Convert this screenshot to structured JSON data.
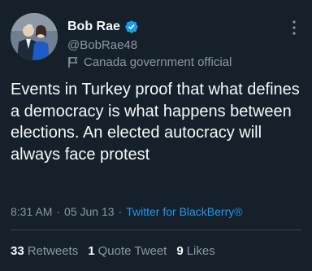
{
  "author": {
    "display_name": "Bob Rae",
    "handle": "@BobRae48",
    "verified": true,
    "label": "Canada government official"
  },
  "tweet": {
    "text": "Events in Turkey proof that what defines a democracy is what happens between elections. An elected autocracy will always face protest",
    "time": "8:31 AM",
    "separator": "·",
    "date": "05 Jun 13",
    "source": "Twitter for BlackBerry®"
  },
  "stats": {
    "retweets_count": "33",
    "retweets_label": "Retweets",
    "quote_count": "1",
    "quote_label": "Quote Tweet",
    "likes_count": "9",
    "likes_label": "Likes"
  },
  "colors": {
    "background": "#15202b",
    "text_primary": "#f7f9f9",
    "text_secondary": "#8b98a5",
    "accent": "#1d9bf0",
    "divider": "#38444d"
  },
  "icons": {
    "verified": "verified-badge-icon",
    "label": "flag-icon",
    "more": "more-dots-icon"
  }
}
